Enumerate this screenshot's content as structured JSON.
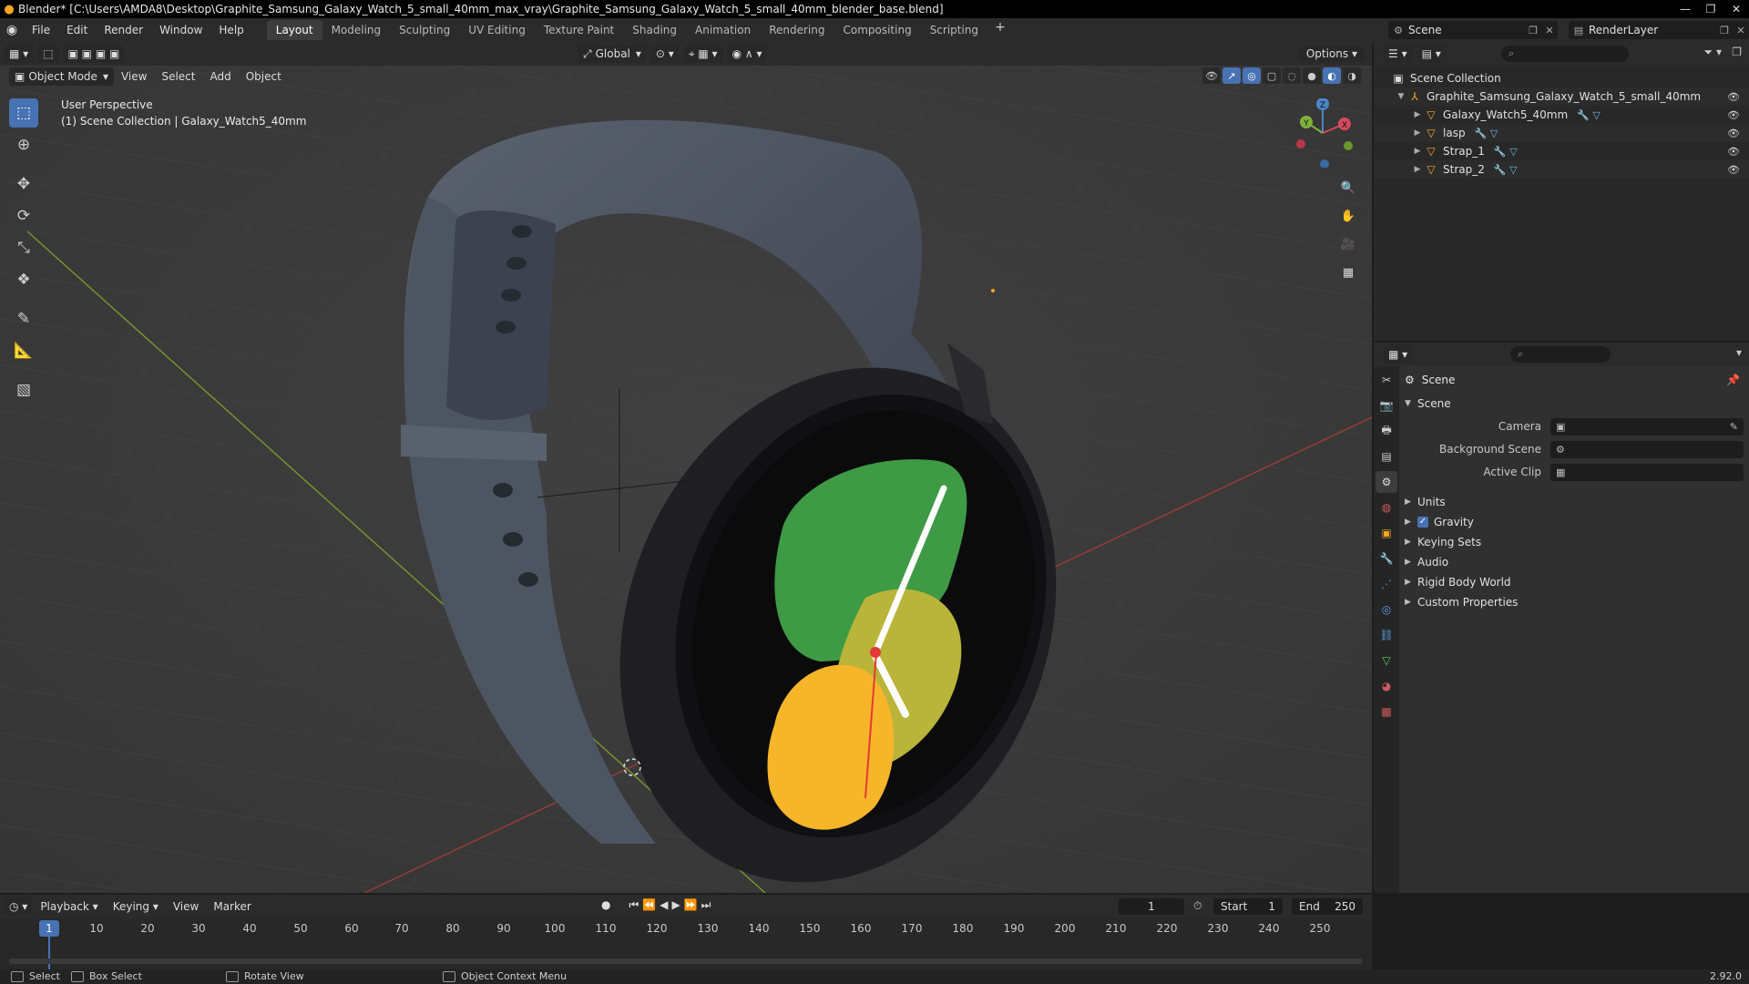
{
  "titlebar": {
    "title": "Blender* [C:\\Users\\AMDA8\\Desktop\\Graphite_Samsung_Galaxy_Watch_5_small_40mm_max_vray\\Graphite_Samsung_Galaxy_Watch_5_small_40mm_blender_base.blend]"
  },
  "menu": [
    "File",
    "Edit",
    "Render",
    "Window",
    "Help"
  ],
  "workspaces": [
    {
      "label": "Layout",
      "active": true
    },
    {
      "label": "Modeling"
    },
    {
      "label": "Sculpting"
    },
    {
      "label": "UV Editing"
    },
    {
      "label": "Texture Paint"
    },
    {
      "label": "Shading"
    },
    {
      "label": "Animation"
    },
    {
      "label": "Rendering"
    },
    {
      "label": "Compositing"
    },
    {
      "label": "Scripting"
    }
  ],
  "scene_selector": "Scene",
  "render_layer": "RenderLayer",
  "viewport": {
    "transform_orientation": "Global",
    "options_label": "Options",
    "mode": "Object Mode",
    "menus": [
      "View",
      "Select",
      "Add",
      "Object"
    ],
    "overlay_line1": "User Perspective",
    "overlay_line2": "(1) Scene Collection | Galaxy_Watch5_40mm",
    "gizmo_labels": {
      "x": "X",
      "y": "Y",
      "z": "Z"
    }
  },
  "outliner": {
    "root": "Scene Collection",
    "collection": "Graphite_Samsung_Galaxy_Watch_5_small_40mm",
    "objects": [
      "Galaxy_Watch5_40mm",
      "lasp",
      "Strap_1",
      "Strap_2"
    ]
  },
  "properties": {
    "context_title": "Scene",
    "panel_scene": "Scene",
    "fields": [
      {
        "label": "Camera"
      },
      {
        "label": "Background Scene"
      },
      {
        "label": "Active Clip"
      }
    ],
    "subpanels": [
      "Units",
      "Gravity",
      "Keying Sets",
      "Audio",
      "Rigid Body World",
      "Custom Properties"
    ]
  },
  "timeline": {
    "menus": [
      "Playback",
      "Keying",
      "View",
      "Marker"
    ],
    "current_frame": "1",
    "start_label": "Start",
    "start_value": "1",
    "end_label": "End",
    "end_value": "250",
    "ticks": [
      "10",
      "20",
      "30",
      "40",
      "50",
      "60",
      "70",
      "80",
      "90",
      "100",
      "110",
      "120",
      "130",
      "140",
      "150",
      "160",
      "170",
      "180",
      "190",
      "200",
      "210",
      "220",
      "230",
      "240",
      "250"
    ]
  },
  "statusbar": {
    "select": "Select",
    "box_select": "Box Select",
    "rotate_view": "Rotate View",
    "context_menu": "Object Context Menu",
    "version": "2.92.0"
  },
  "colors": {
    "accent": "#4772b3",
    "object_orange": "#f5a623",
    "face_green": "#3f9a45",
    "face_yellow": "#f7b52a"
  }
}
